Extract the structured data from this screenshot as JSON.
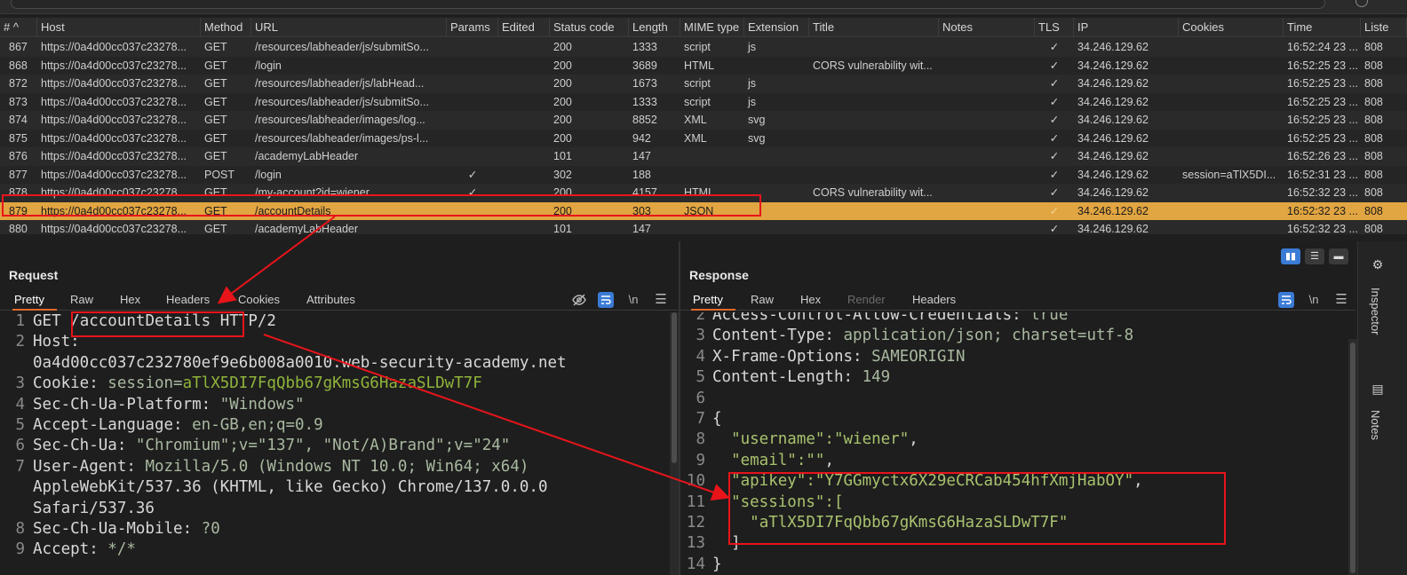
{
  "table": {
    "headers": [
      "# ^",
      "Host",
      "Method",
      "URL",
      "Params",
      "Edited",
      "Status code",
      "Length",
      "MIME type",
      "Extension",
      "Title",
      "Notes",
      "TLS",
      "IP",
      "Cookies",
      "Time",
      "Liste"
    ],
    "rows": [
      {
        "num": "867",
        "host": "https://0a4d00cc037c23278...",
        "method": "GET",
        "url": "/resources/labheader/js/submitSo...",
        "params": "",
        "status": "200",
        "length": "1333",
        "mime": "script",
        "ext": "js",
        "title": "",
        "tls": "✓",
        "ip": "34.246.129.62",
        "cookies": "",
        "time": "16:52:24 23 ...",
        "listener": "808"
      },
      {
        "num": "868",
        "host": "https://0a4d00cc037c23278...",
        "method": "GET",
        "url": "/login",
        "params": "",
        "status": "200",
        "length": "3689",
        "mime": "HTML",
        "ext": "",
        "title": "CORS vulnerability wit...",
        "tls": "✓",
        "ip": "34.246.129.62",
        "cookies": "",
        "time": "16:52:25 23 ...",
        "listener": "808"
      },
      {
        "num": "872",
        "host": "https://0a4d00cc037c23278...",
        "method": "GET",
        "url": "/resources/labheader/js/labHead...",
        "params": "",
        "status": "200",
        "length": "1673",
        "mime": "script",
        "ext": "js",
        "title": "",
        "tls": "✓",
        "ip": "34.246.129.62",
        "cookies": "",
        "time": "16:52:25 23 ...",
        "listener": "808"
      },
      {
        "num": "873",
        "host": "https://0a4d00cc037c23278...",
        "method": "GET",
        "url": "/resources/labheader/js/submitSo...",
        "params": "",
        "status": "200",
        "length": "1333",
        "mime": "script",
        "ext": "js",
        "title": "",
        "tls": "✓",
        "ip": "34.246.129.62",
        "cookies": "",
        "time": "16:52:25 23 ...",
        "listener": "808"
      },
      {
        "num": "874",
        "host": "https://0a4d00cc037c23278...",
        "method": "GET",
        "url": "/resources/labheader/images/log...",
        "params": "",
        "status": "200",
        "length": "8852",
        "mime": "XML",
        "ext": "svg",
        "title": "",
        "tls": "✓",
        "ip": "34.246.129.62",
        "cookies": "",
        "time": "16:52:25 23 ...",
        "listener": "808"
      },
      {
        "num": "875",
        "host": "https://0a4d00cc037c23278...",
        "method": "GET",
        "url": "/resources/labheader/images/ps-l...",
        "params": "",
        "status": "200",
        "length": "942",
        "mime": "XML",
        "ext": "svg",
        "title": "",
        "tls": "✓",
        "ip": "34.246.129.62",
        "cookies": "",
        "time": "16:52:25 23 ...",
        "listener": "808"
      },
      {
        "num": "876",
        "host": "https://0a4d00cc037c23278...",
        "method": "GET",
        "url": "/academyLabHeader",
        "params": "",
        "status": "101",
        "length": "147",
        "mime": "",
        "ext": "",
        "title": "",
        "tls": "✓",
        "ip": "34.246.129.62",
        "cookies": "",
        "time": "16:52:26 23 ...",
        "listener": "808"
      },
      {
        "num": "877",
        "host": "https://0a4d00cc037c23278...",
        "method": "POST",
        "url": "/login",
        "params": "✓",
        "status": "302",
        "length": "188",
        "mime": "",
        "ext": "",
        "title": "",
        "tls": "✓",
        "ip": "34.246.129.62",
        "cookies": "session=aTlX5DI...",
        "time": "16:52:31 23 ...",
        "listener": "808"
      },
      {
        "num": "878",
        "host": "https://0a4d00cc037c23278...",
        "method": "GET",
        "url": "/my-account?id=wiener",
        "params": "✓",
        "status": "200",
        "length": "4157",
        "mime": "HTML",
        "ext": "",
        "title": "CORS vulnerability wit...",
        "tls": "✓",
        "ip": "34.246.129.62",
        "cookies": "",
        "time": "16:52:32 23 ...",
        "listener": "808"
      },
      {
        "num": "879",
        "host": "https://0a4d00cc037c23278...",
        "method": "GET",
        "url": "/accountDetails",
        "params": "",
        "status": "200",
        "length": "303",
        "mime": "JSON",
        "ext": "",
        "title": "",
        "tls": "✓",
        "ip": "34.246.129.62",
        "cookies": "",
        "time": "16:52:32 23 ...",
        "listener": "808"
      },
      {
        "num": "880",
        "host": "https://0a4d00cc037c23278...",
        "method": "GET",
        "url": "/academyLabHeader",
        "params": "",
        "status": "101",
        "length": "147",
        "mime": "",
        "ext": "",
        "title": "",
        "tls": "✓",
        "ip": "34.246.129.62",
        "cookies": "",
        "time": "16:52:32 23 ...",
        "listener": "808"
      }
    ]
  },
  "request": {
    "title": "Request",
    "tabs": [
      "Pretty",
      "Raw",
      "Hex",
      "Headers",
      "Cookies",
      "Attributes"
    ],
    "icons": [
      "eye-off-icon",
      "wrap-icon",
      "newline-icon",
      "menu-icon"
    ],
    "newline_label": "\\n",
    "lines": [
      {
        "n": "1",
        "parts": [
          {
            "t": "GET "
          },
          {
            "t": "/accountDetails"
          },
          {
            "t": " HTTP/2"
          }
        ]
      },
      {
        "n": "2",
        "parts": [
          {
            "t": "Host:"
          }
        ]
      },
      {
        "n": "",
        "parts": [
          {
            "t": "0a4d00cc037c232780ef9e6b008a0010.web-security-academy.net"
          }
        ]
      },
      {
        "n": "3",
        "parts": [
          {
            "t": "Cookie: "
          },
          {
            "t": "session="
          },
          {
            "t": "aTlX5DI7FqQbb67gKmsG6HazaSLDwT7F"
          }
        ]
      },
      {
        "n": "4",
        "parts": [
          {
            "t": "Sec-Ch-Ua-Platform: "
          },
          {
            "t": "\"Windows\""
          }
        ]
      },
      {
        "n": "5",
        "parts": [
          {
            "t": "Accept-Language: "
          },
          {
            "t": "en-GB,en;q=0.9"
          }
        ]
      },
      {
        "n": "6",
        "parts": [
          {
            "t": "Sec-Ch-Ua: "
          },
          {
            "t": "\"Chromium\";v=\"137\", \"Not/A)Brand\";v=\"24\""
          }
        ]
      },
      {
        "n": "7",
        "parts": [
          {
            "t": "User-Agent: "
          },
          {
            "t": "Mozilla/5.0 (Windows NT 10.0; Win64; x64)"
          }
        ]
      },
      {
        "n": "",
        "parts": [
          {
            "t": "AppleWebKit/537.36 (KHTML, like Gecko) Chrome/137.0.0.0"
          }
        ]
      },
      {
        "n": "",
        "parts": [
          {
            "t": "Safari/537.36"
          }
        ]
      },
      {
        "n": "8",
        "parts": [
          {
            "t": "Sec-Ch-Ua-Mobile: "
          },
          {
            "t": "?0"
          }
        ]
      },
      {
        "n": "9",
        "parts": [
          {
            "t": "Accept: "
          },
          {
            "t": "*/*"
          }
        ]
      }
    ]
  },
  "response": {
    "title": "Response",
    "tabs": [
      "Pretty",
      "Raw",
      "Hex",
      "Render",
      "Headers"
    ],
    "newline_label": "\\n",
    "lines": [
      {
        "n": "2",
        "parts": [
          {
            "t": "Access-Control-Allow-Credentials: "
          },
          {
            "t": "true"
          }
        ]
      },
      {
        "n": "3",
        "parts": [
          {
            "t": "Content-Type: "
          },
          {
            "t": "application/json; charset=utf-8"
          }
        ]
      },
      {
        "n": "4",
        "parts": [
          {
            "t": "X-Frame-Options: "
          },
          {
            "t": "SAMEORIGIN"
          }
        ]
      },
      {
        "n": "5",
        "parts": [
          {
            "t": "Content-Length: "
          },
          {
            "t": "149"
          }
        ]
      },
      {
        "n": "6",
        "parts": [
          {
            "t": ""
          }
        ]
      },
      {
        "n": "7",
        "parts": [
          {
            "t": "{"
          }
        ]
      },
      {
        "n": "8",
        "parts": [
          {
            "t": "  \"username\":"
          },
          {
            "t": "\"wiener\""
          },
          {
            "t": ","
          }
        ]
      },
      {
        "n": "9",
        "parts": [
          {
            "t": "  \"email\":"
          },
          {
            "t": "\"\""
          },
          {
            "t": ","
          }
        ]
      },
      {
        "n": "10",
        "parts": [
          {
            "t": "  \"apikey\":"
          },
          {
            "t": "\"Y7GGmyctx6X29eCRCab454hfXmjHabOY\""
          },
          {
            "t": ","
          }
        ]
      },
      {
        "n": "11",
        "parts": [
          {
            "t": "  \"sessions\":["
          }
        ]
      },
      {
        "n": "12",
        "parts": [
          {
            "t": "    "
          },
          {
            "t": "\"aTlX5DI7FqQbb67gKmsG6HazaSLDwT7F\""
          }
        ]
      },
      {
        "n": "13",
        "parts": [
          {
            "t": "  ]"
          }
        ]
      },
      {
        "n": "14",
        "parts": [
          {
            "t": "}"
          }
        ]
      }
    ]
  },
  "sidebar": {
    "items": [
      "Inspector",
      "Notes"
    ]
  },
  "colors": {
    "accent": "#e06b2a",
    "selected_row": "#e1a541",
    "annotation": "#e8141a",
    "blue": "#3a7bd5"
  }
}
